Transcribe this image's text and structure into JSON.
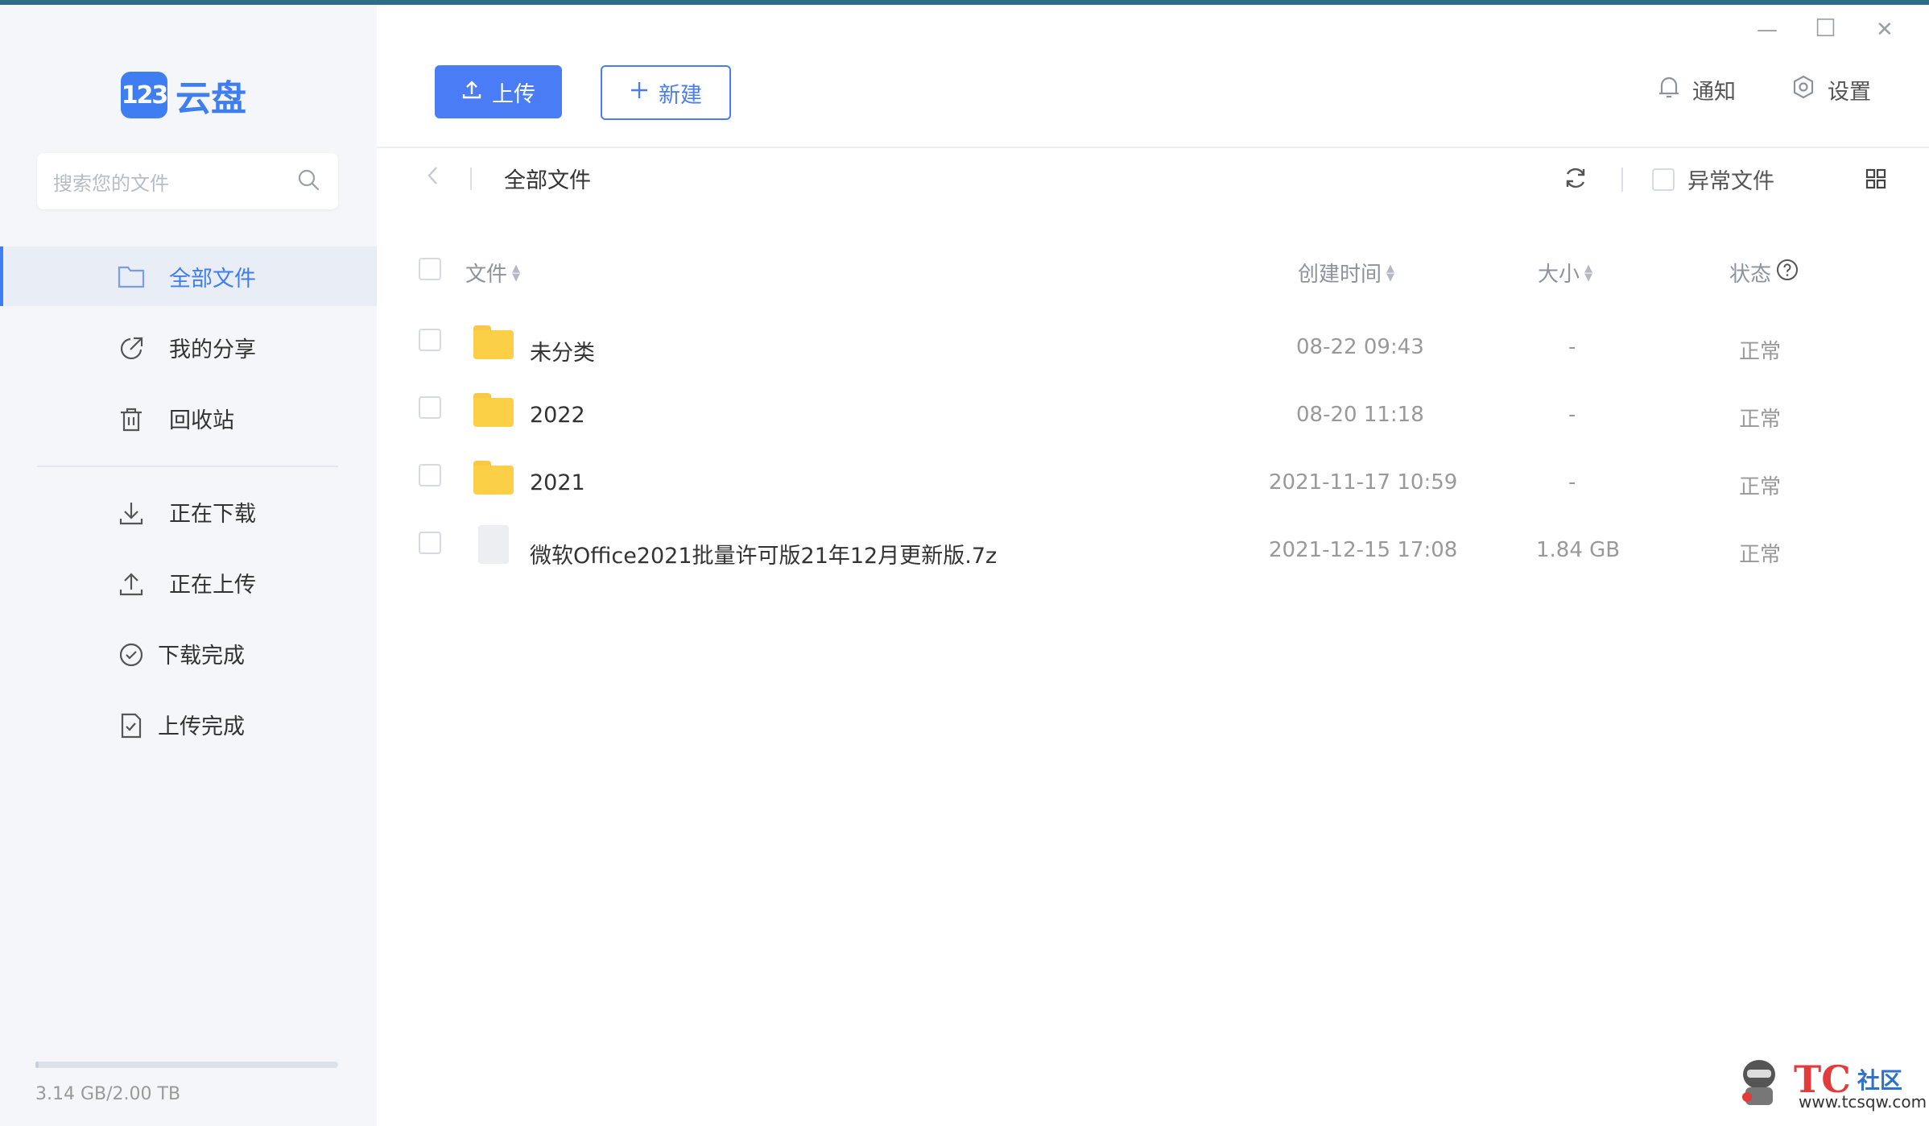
{
  "app": {
    "logo_badge": "123",
    "logo_text": "云盘",
    "brand_color": "#3f7df3"
  },
  "window": {
    "minimize": "—",
    "maximize": "☐",
    "close": "✕"
  },
  "sidebar": {
    "search_placeholder": "搜索您的文件",
    "items": [
      {
        "label": "全部文件",
        "icon": "folder-icon",
        "active": true
      },
      {
        "label": "我的分享",
        "icon": "share-icon"
      },
      {
        "label": "回收站",
        "icon": "trash-icon"
      },
      {
        "label": "正在下载",
        "icon": "download-icon"
      },
      {
        "label": "正在上传",
        "icon": "upload-icon"
      },
      {
        "label": "下载完成",
        "icon": "check-circle-icon"
      },
      {
        "label": "上传完成",
        "icon": "file-check-icon"
      }
    ],
    "storage": {
      "text": "3.14 GB/2.00 TB",
      "used_fraction": 0.0015
    }
  },
  "toolbar": {
    "upload_label": "上传",
    "new_label": "新建",
    "notify_label": "通知",
    "settings_label": "设置"
  },
  "breadcrumb": {
    "title": "全部文件"
  },
  "filter": {
    "abnormal_label": "异常文件"
  },
  "table": {
    "headers": {
      "name": "文件",
      "created": "创建时间",
      "size": "大小",
      "status": "状态"
    },
    "rows": [
      {
        "name": "未分类",
        "type": "folder",
        "created": "08-22 09:43",
        "size": "-",
        "status": "正常"
      },
      {
        "name": "2022",
        "type": "folder",
        "created": "08-20 11:18",
        "size": "-",
        "status": "正常"
      },
      {
        "name": "2021",
        "type": "folder",
        "created": "2021-11-17 10:59",
        "size": "-",
        "status": "正常"
      },
      {
        "name": "微软Office2021批量许可版21年12月更新版.7z",
        "type": "file",
        "created": "2021-12-15 17:08",
        "size": "1.84 GB",
        "status": "正常"
      }
    ]
  },
  "watermark": {
    "main": "TC",
    "sub": "社区",
    "url": "www.tcsqw.com"
  }
}
